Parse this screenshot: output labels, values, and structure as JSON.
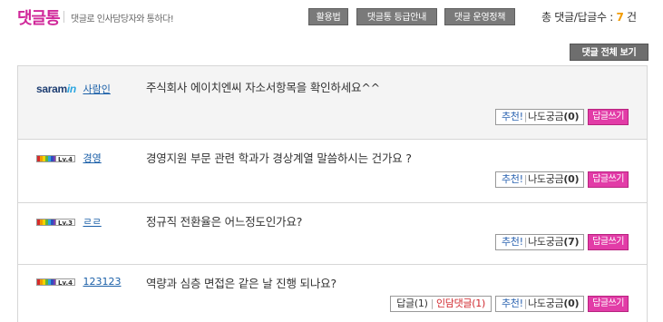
{
  "header": {
    "logo": "댓글통",
    "tagline": "댓글로 인사담당자와 통하다!",
    "buttons": [
      "활용법",
      "댓글통 등급안내",
      "댓글 운영정책"
    ],
    "count_label": "총 댓글/답글수 : ",
    "count_value": "7",
    "count_unit": " 건"
  },
  "view_all": "댓글 전체 보기",
  "posts": [
    {
      "author_logo_main": "saram",
      "author_logo_in": "in",
      "author": "사람인",
      "question": "주식회사 에이치엔씨 자소서항목을 확인하세요^^",
      "vote_recommend": "추천!",
      "vote_label": "나도궁금",
      "vote_count": "(0)",
      "reply": "답글쓰기"
    },
    {
      "level": "Lv.4",
      "author": "경영",
      "question": "경영지원 부문 관련 학과가 경상계열 말씀하시는 건가요 ?",
      "vote_recommend": "추천!",
      "vote_label": "나도궁금",
      "vote_count": "(0)",
      "reply": "답글쓰기"
    },
    {
      "level": "Lv.3",
      "author": "ㄹㄹ",
      "question": "정규직 전환율은 어느정도인가요?",
      "vote_recommend": "추천!",
      "vote_label": "나도궁금",
      "vote_count": "(7)",
      "reply": "답글쓰기"
    },
    {
      "level": "Lv.4",
      "author": "123123",
      "question": "역량과 심층 면접은 같은 날 진행 되나요?",
      "replies_label": "답글(1)",
      "hr_replies_label": "인담댓글(1)",
      "vote_recommend": "추천!",
      "vote_label": "나도궁금",
      "vote_count": "(0)",
      "reply": "답글쓰기"
    }
  ],
  "colors": {
    "brand": "#d0289a",
    "reply_button": "#e23ca7",
    "count_highlight": "#f29b00",
    "link": "#1a5fa8"
  }
}
